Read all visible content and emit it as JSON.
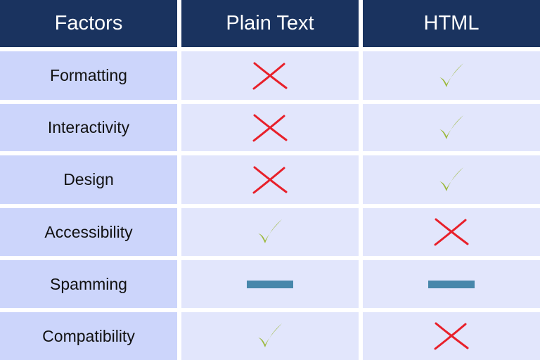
{
  "colors": {
    "header_bg": "#1a335f",
    "header_text": "#ffffff",
    "factor_bg": "#ccd5fb",
    "value_bg": "#e2e6fc",
    "check": "#9bb83a",
    "cross": "#e8202a",
    "dash": "#4787ab"
  },
  "table": {
    "headers": [
      "Factors",
      "Plain Text",
      "HTML"
    ],
    "rows": [
      {
        "factor": "Formatting",
        "plain_text": "cross",
        "html": "check"
      },
      {
        "factor": "Interactivity",
        "plain_text": "cross",
        "html": "check"
      },
      {
        "factor": "Design",
        "plain_text": "cross",
        "html": "check"
      },
      {
        "factor": "Accessibility",
        "plain_text": "check",
        "html": "cross"
      },
      {
        "factor": "Spamming",
        "plain_text": "dash",
        "html": "dash"
      },
      {
        "factor": "Compatibility",
        "plain_text": "check",
        "html": "cross"
      }
    ]
  }
}
